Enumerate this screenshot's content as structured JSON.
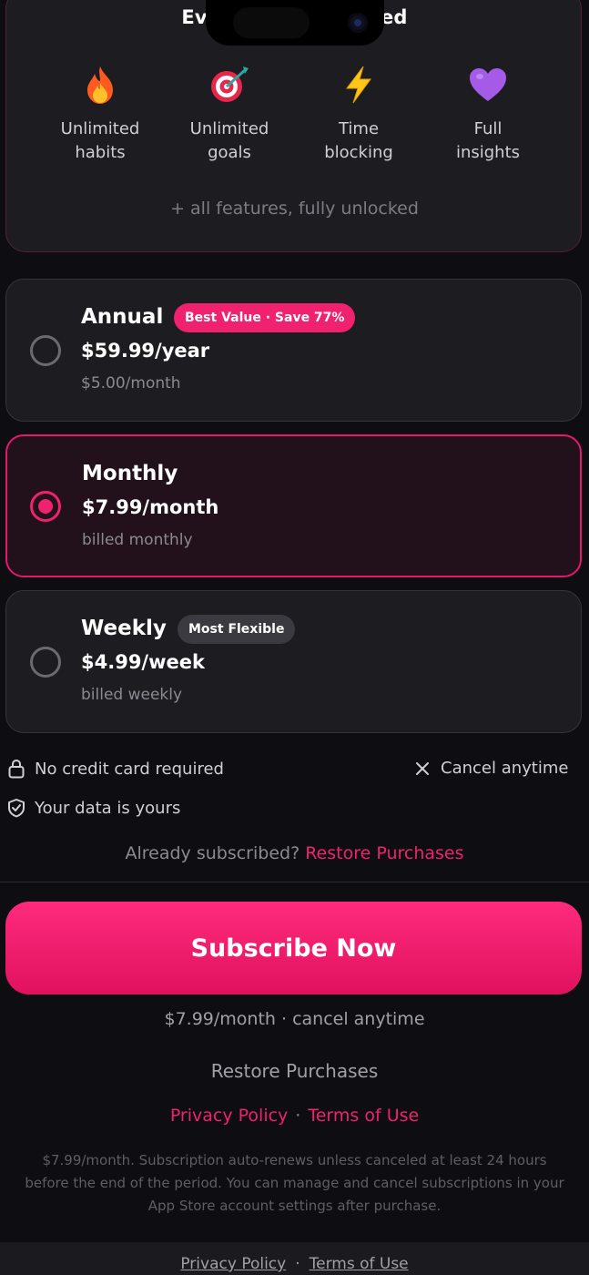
{
  "features": {
    "title": "Everything Unlocked",
    "items": [
      {
        "label_line1": "Unlimited",
        "label_line2": "habits",
        "icon": "fire-icon"
      },
      {
        "label_line1": "Unlimited",
        "label_line2": "goals",
        "icon": "target-icon"
      },
      {
        "label_line1": "Time",
        "label_line2": "blocking",
        "icon": "lightning-icon"
      },
      {
        "label_line1": "Full",
        "label_line2": "insights",
        "icon": "purple-heart-icon"
      }
    ],
    "subtitle": "+ all features, fully unlocked"
  },
  "plans": [
    {
      "name": "Annual",
      "badge": "Best Value · Save 77%",
      "price": "$59.99/year",
      "sub": "$5.00/month",
      "selected": false
    },
    {
      "name": "Monthly",
      "badge": "",
      "price": "$7.99/month",
      "sub": "billed monthly",
      "selected": true
    },
    {
      "name": "Weekly",
      "badge": "Most Flexible",
      "price": "$4.99/week",
      "sub": "billed weekly",
      "selected": false
    }
  ],
  "trust": {
    "no_card": "No credit card required",
    "cancel": "Cancel anytime",
    "data": "Your data is yours"
  },
  "already": {
    "text": "Already subscribed?",
    "link": "Restore Purchases"
  },
  "cta": {
    "subscribe": "Subscribe Now",
    "price_note": "$7.99/month · cancel anytime",
    "restore": "Restore Purchases"
  },
  "legal": {
    "privacy": "Privacy Policy",
    "terms": "Terms of Use",
    "fineprint": "$7.99/month. Subscription auto-renews unless canceled at least 24 hours before the end of the period. You can manage and cancel subscriptions in your App Store account settings after purchase."
  },
  "bottom": {
    "privacy": "Privacy Policy",
    "terms": "Terms of Use"
  },
  "colors": {
    "accent": "#f0216f",
    "background": "#0d0d12",
    "card": "#1c1c21"
  }
}
